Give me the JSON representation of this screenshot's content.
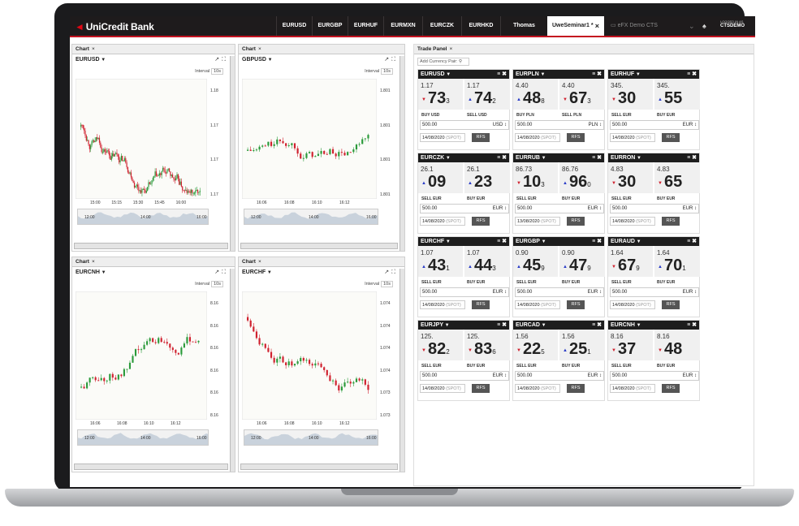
{
  "app": {
    "logo": "UniCredit Bank"
  },
  "topbar": {
    "pair_tabs": [
      "EURUSD",
      "EURGBP",
      "EURHUF",
      "EURMXN",
      "EURCZK",
      "EURHKD"
    ],
    "user_tab": "Thomas",
    "workspaces": [
      {
        "label": "UweSeminar1 *",
        "close": "×",
        "active": true
      },
      {
        "label": "eFX Demo CTS",
        "active": false
      }
    ],
    "login": {
      "caption": "LOGGED IN AS",
      "user": "CTSDEMO"
    }
  },
  "charts": [
    {
      "tab": "Chart",
      "pair": "EURUSD",
      "interval_label": "Interval",
      "interval": "10s",
      "ylabels": [
        "1.18",
        "1.17",
        "1.17",
        "1.17"
      ],
      "xlabels": [
        "15:00",
        "15:15",
        "15:30",
        "15:45",
        "16:00"
      ],
      "nav": [
        "12:00",
        "14:00",
        "16:00"
      ]
    },
    {
      "tab": "Chart",
      "pair": "GBPUSD",
      "interval_label": "Interval",
      "interval": "10s",
      "ylabels": [
        "1.801",
        "1.801",
        "1.801",
        "1.801"
      ],
      "xlabels": [
        "16:06",
        "16:08",
        "16:10",
        "16:12"
      ],
      "nav": [
        "12:00",
        "14:00",
        "16:00"
      ]
    },
    {
      "tab": "Chart",
      "pair": "EURCNH",
      "interval_label": "Interval",
      "interval": "10s",
      "ylabels": [
        "8.16",
        "8.16",
        "8.16",
        "8.16",
        "8.16",
        "8.16"
      ],
      "xlabels": [
        "16:06",
        "16:08",
        "16:10",
        "16:12"
      ],
      "nav": [
        "12:00",
        "14:00",
        "16:00"
      ]
    },
    {
      "tab": "Chart",
      "pair": "EURCHF",
      "interval_label": "Interval",
      "interval": "10s",
      "ylabels": [
        "1.074",
        "1.074",
        "1.074",
        "1.074",
        "1.073",
        "1.073"
      ],
      "xlabels": [
        "16:06",
        "16:08",
        "16:10",
        "16:12"
      ],
      "nav": [
        "12:00",
        "14:00",
        "16:00"
      ]
    }
  ],
  "trade_panel": {
    "tab": "Trade Panel",
    "add_pair": "Add Currency Pair:",
    "rfs": "RFS",
    "tiles": [
      {
        "pair": "EURUSD",
        "sell_big": "1.17",
        "sell_pips": "73",
        "sell_frac": "3",
        "buy_big": "1.17",
        "buy_pips": "74",
        "buy_frac": "2",
        "sell_label": "BUY USD",
        "buy_label": "SELL USD",
        "amount": "500.00",
        "ccy": "USD",
        "date": "14/08/2020",
        "tenor": "(SPOT)"
      },
      {
        "pair": "EURPLN",
        "sell_big": "4.40",
        "sell_pips": "48",
        "sell_frac": "8",
        "buy_big": "4.40",
        "buy_pips": "67",
        "buy_frac": "3",
        "sell_label": "BUY PLN",
        "buy_label": "SELL PLN",
        "amount": "500.00",
        "ccy": "PLN",
        "date": "14/08/2020",
        "tenor": "(SPOT)"
      },
      {
        "pair": "EURHUF",
        "sell_big": "345.",
        "sell_pips": "30",
        "sell_frac": "",
        "buy_big": "345.",
        "buy_pips": "55",
        "buy_frac": "",
        "sell_label": "SELL EUR",
        "buy_label": "BUY EUR",
        "amount": "500.00",
        "ccy": "EUR",
        "date": "14/08/2020",
        "tenor": "(SPOT)"
      },
      {
        "pair": "EURCZK",
        "sell_big": "26.1",
        "sell_pips": "09",
        "sell_frac": "",
        "buy_big": "26.1",
        "buy_pips": "23",
        "buy_frac": "",
        "sell_label": "SELL EUR",
        "buy_label": "BUY EUR",
        "amount": "500.00",
        "ccy": "EUR",
        "date": "14/08/2020",
        "tenor": "(SPOT)"
      },
      {
        "pair": "EURRUB",
        "sell_big": "86.73",
        "sell_pips": "10",
        "sell_frac": "3",
        "buy_big": "86.76",
        "buy_pips": "96",
        "buy_frac": "0",
        "sell_label": "SELL EUR",
        "buy_label": "BUY EUR",
        "amount": "500.00",
        "ccy": "EUR",
        "date": "13/08/2020",
        "tenor": "(SPOT)"
      },
      {
        "pair": "EURRON",
        "sell_big": "4.83",
        "sell_pips": "30",
        "sell_frac": "",
        "buy_big": "4.83",
        "buy_pips": "65",
        "buy_frac": "",
        "sell_label": "SELL EUR",
        "buy_label": "BUY EUR",
        "amount": "500.00",
        "ccy": "EUR",
        "date": "14/08/2020",
        "tenor": "(SPOT)"
      },
      {
        "pair": "EURCHF",
        "sell_big": "1.07",
        "sell_pips": "43",
        "sell_frac": "1",
        "buy_big": "1.07",
        "buy_pips": "44",
        "buy_frac": "3",
        "sell_label": "SELL EUR",
        "buy_label": "BUY EUR",
        "amount": "500.00",
        "ccy": "EUR",
        "date": "14/08/2020",
        "tenor": "(SPOT)"
      },
      {
        "pair": "EURGBP",
        "sell_big": "0.90",
        "sell_pips": "45",
        "sell_frac": "9",
        "buy_big": "0.90",
        "buy_pips": "47",
        "buy_frac": "9",
        "sell_label": "SELL EUR",
        "buy_label": "BUY EUR",
        "amount": "500.00",
        "ccy": "EUR",
        "date": "14/08/2020",
        "tenor": "(SPOT)"
      },
      {
        "pair": "EURAUD",
        "sell_big": "1.64",
        "sell_pips": "67",
        "sell_frac": "9",
        "buy_big": "1.64",
        "buy_pips": "70",
        "buy_frac": "1",
        "sell_label": "SELL EUR",
        "buy_label": "BUY EUR",
        "amount": "500.00",
        "ccy": "EUR",
        "date": "14/08/2020",
        "tenor": "(SPOT)"
      },
      {
        "pair": "EURJPY",
        "sell_big": "125.",
        "sell_pips": "82",
        "sell_frac": "2",
        "buy_big": "125.",
        "buy_pips": "83",
        "buy_frac": "6",
        "sell_label": "SELL EUR",
        "buy_label": "BUY EUR",
        "amount": "500.00",
        "ccy": "EUR",
        "date": "14/08/2020",
        "tenor": "(SPOT)"
      },
      {
        "pair": "EURCAD",
        "sell_big": "1.56",
        "sell_pips": "22",
        "sell_frac": "5",
        "buy_big": "1.56",
        "buy_pips": "25",
        "buy_frac": "1",
        "sell_label": "SELL EUR",
        "buy_label": "BUY EUR",
        "amount": "500.00",
        "ccy": "EUR",
        "date": "14/08/2020",
        "tenor": "(SPOT)"
      },
      {
        "pair": "EURCNH",
        "sell_big": "8.16",
        "sell_pips": "37",
        "sell_frac": "",
        "buy_big": "8.16",
        "buy_pips": "48",
        "buy_frac": "",
        "sell_label": "SELL EUR",
        "buy_label": "BUY EUR",
        "amount": "500.00",
        "ccy": "EUR",
        "date": "14/08/2020",
        "tenor": "(SPOT)"
      }
    ]
  },
  "colors": {
    "brand": "#c4121f",
    "up": "#2a3cc7",
    "down": "#d0212f",
    "candle_up": "#2a9a3a",
    "candle_down": "#d0212f"
  }
}
